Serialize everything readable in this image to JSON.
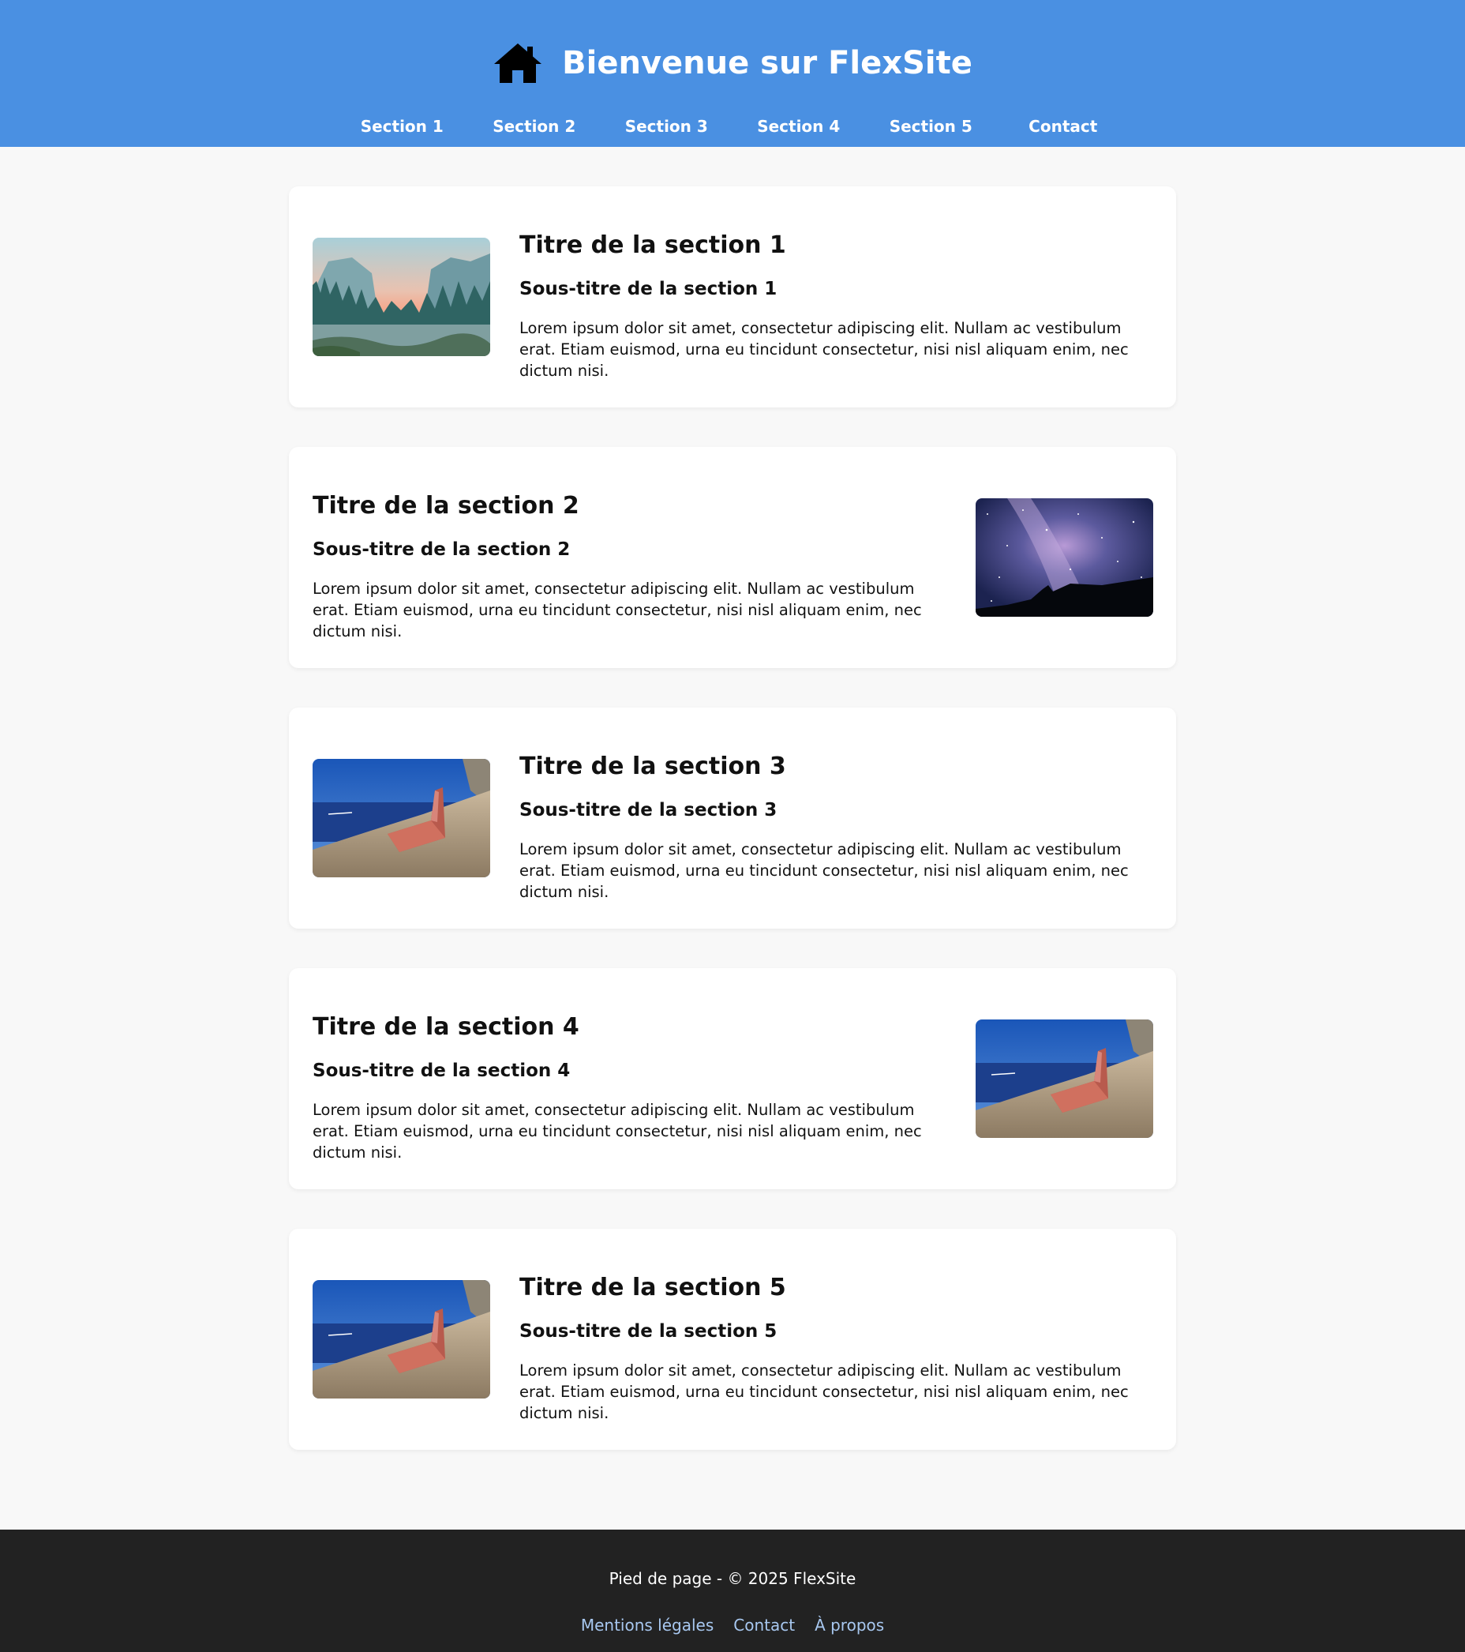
{
  "header": {
    "title": "Bienvenue sur FlexSite",
    "icon": "home-icon",
    "background": "#4a90e2"
  },
  "nav": {
    "items": [
      "Section 1",
      "Section 2",
      "Section 3",
      "Section 4",
      "Section 5",
      "Contact"
    ]
  },
  "sections": [
    {
      "title": "Titre de la section 1",
      "subtitle": "Sous-titre de la section 1",
      "body": "Lorem ipsum dolor sit amet, consectetur adipiscing elit. Nullam ac vestibulum erat. Etiam euismod, urna eu tincidunt consectetur, nisi nisl aliquam enim, nec dictum nisi.",
      "image": "mountain-valley-image"
    },
    {
      "title": "Titre de la section 2",
      "subtitle": "Sous-titre de la section 2",
      "body": "Lorem ipsum dolor sit amet, consectetur adipiscing elit. Nullam ac vestibulum erat. Etiam euismod, urna eu tincidunt consectetur, nisi nisl aliquam enim, nec dictum nisi.",
      "image": "milky-way-image"
    },
    {
      "title": "Titre de la section 3",
      "subtitle": "Sous-titre de la section 3",
      "body": "Lorem ipsum dolor sit amet, consectetur adipiscing elit. Nullam ac vestibulum erat. Etiam euismod, urna eu tincidunt consectetur, nisi nisl aliquam enim, nec dictum nisi.",
      "image": "armchair-by-sea-image"
    },
    {
      "title": "Titre de la section 4",
      "subtitle": "Sous-titre de la section 4",
      "body": "Lorem ipsum dolor sit amet, consectetur adipiscing elit. Nullam ac vestibulum erat. Etiam euismod, urna eu tincidunt consectetur, nisi nisl aliquam enim, nec dictum nisi.",
      "image": "armchair-by-sea-image"
    },
    {
      "title": "Titre de la section 5",
      "subtitle": "Sous-titre de la section 5",
      "body": "Lorem ipsum dolor sit amet, consectetur adipiscing elit. Nullam ac vestibulum erat. Etiam euismod, urna eu tincidunt consectetur, nisi nisl aliquam enim, nec dictum nisi.",
      "image": "armchair-by-sea-image"
    }
  ],
  "footer": {
    "text": "Pied de page - © 2025 FlexSite",
    "links": [
      "Mentions légales",
      "Contact",
      "À propos"
    ],
    "background": "#222222",
    "link_color": "#a8c8f0"
  }
}
